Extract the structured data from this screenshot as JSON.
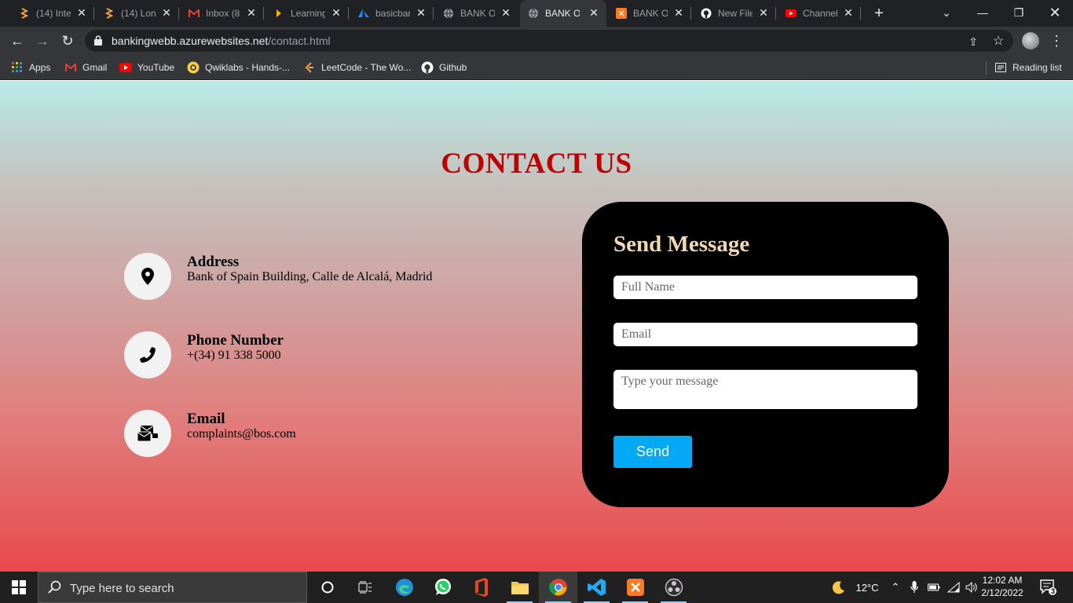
{
  "browser": {
    "tabs": [
      {
        "title": "(14) Inte",
        "favicon": "codeforces-favicon",
        "active": false
      },
      {
        "title": "(14) Lon",
        "favicon": "codeforces-favicon",
        "active": false
      },
      {
        "title": "Inbox (8",
        "favicon": "gmail-favicon",
        "active": false
      },
      {
        "title": "Learning",
        "favicon": "qwiklabs-favicon",
        "active": false
      },
      {
        "title": "basicbar",
        "favicon": "azure-favicon",
        "active": false
      },
      {
        "title": "BANK O",
        "favicon": "globe-favicon",
        "active": false
      },
      {
        "title": "BANK O",
        "favicon": "globe-favicon",
        "active": true
      },
      {
        "title": "BANK O",
        "favicon": "xampp-favicon",
        "active": false
      },
      {
        "title": "New File",
        "favicon": "github-favicon",
        "active": false
      },
      {
        "title": "Channel",
        "favicon": "youtube-favicon",
        "active": false
      }
    ],
    "url_host": "bankingwebb.azurewebsites.net",
    "url_path": "/contact.html",
    "bookmarks": [
      {
        "label": "Apps",
        "icon": "apps-grid-icon"
      },
      {
        "label": "Gmail",
        "icon": "gmail-icon"
      },
      {
        "label": "YouTube",
        "icon": "youtube-icon"
      },
      {
        "label": "Qwiklabs - Hands-...",
        "icon": "qwiklabs-icon"
      },
      {
        "label": "LeetCode - The Wo...",
        "icon": "leetcode-icon"
      },
      {
        "label": "Github",
        "icon": "github-icon"
      }
    ],
    "reading_list": "Reading list"
  },
  "page": {
    "title": "CONTACT US",
    "title_color": "#c00000",
    "contacts": [
      {
        "heading": "Address",
        "value": "Bank of Spain Building, Calle de Alcalá, Madrid",
        "icon": "map-pin-icon"
      },
      {
        "heading": "Phone Number",
        "value": "+(34) 91 338 5000",
        "icon": "phone-icon"
      },
      {
        "heading": "Email",
        "value": "complaints@bos.com",
        "icon": "envelope-icon"
      }
    ],
    "form": {
      "title": "Send Message",
      "name_placeholder": "Full Name",
      "email_placeholder": "Email",
      "message_placeholder": "Type your message",
      "send_label": "Send",
      "button_color": "#03a9f4",
      "title_color": "#f3d9b3"
    }
  },
  "taskbar": {
    "search_placeholder": "Type here to search",
    "apps": [
      "cortana-icon",
      "task-view-icon",
      "edge-icon",
      "whatsapp-icon",
      "office-icon",
      "file-explorer-icon",
      "chrome-icon",
      "vscode-icon",
      "xampp-icon",
      "obs-icon"
    ],
    "weather": "12°C",
    "time": "12:02 AM",
    "date": "2/12/2022",
    "notifications": "3"
  }
}
